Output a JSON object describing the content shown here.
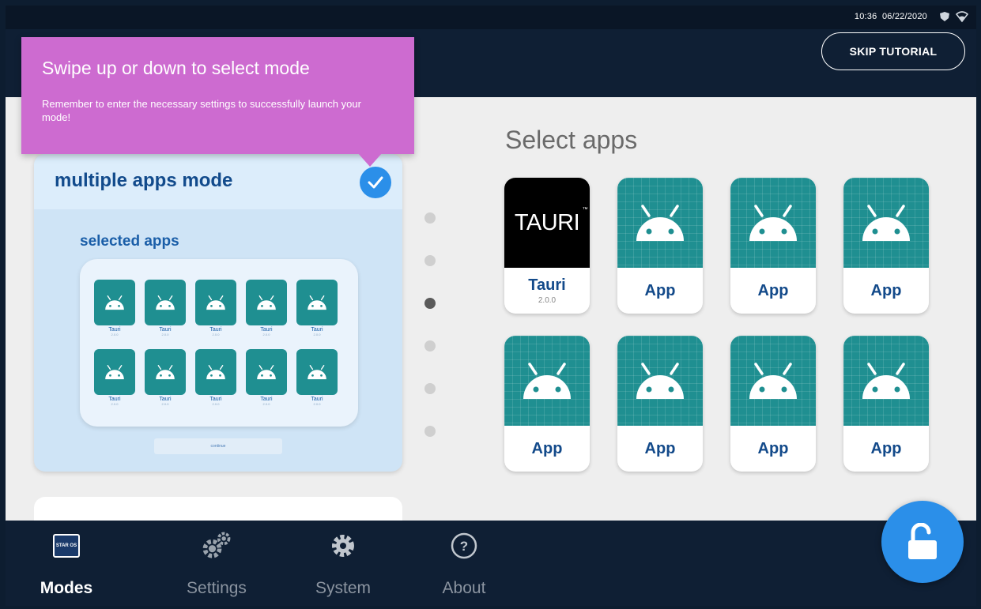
{
  "status_bar": {
    "time": "10:36",
    "date": "06/22/2020",
    "icons": [
      "shield-icon",
      "wifi-icon"
    ]
  },
  "header": {
    "skip_label": "SKIP TUTORIAL"
  },
  "tooltip": {
    "title": "Swipe up or down to select mode",
    "body": "Remember to enter the necessary settings to successfully launch your mode!"
  },
  "mode_card": {
    "title": "multiple apps mode",
    "selected_label": "selected apps",
    "mini_apps": [
      {
        "name": "Tauri",
        "ver": "2.0.0"
      },
      {
        "name": "Tauri",
        "ver": "2.0.0"
      },
      {
        "name": "Tauri",
        "ver": "2.0.0"
      },
      {
        "name": "Tauri",
        "ver": "2.0.0"
      },
      {
        "name": "Tauri",
        "ver": "2.0.0"
      },
      {
        "name": "Tauri",
        "ver": "2.0.0"
      },
      {
        "name": "Tauri",
        "ver": "2.0.0"
      },
      {
        "name": "Tauri",
        "ver": "2.0.0"
      },
      {
        "name": "Tauri",
        "ver": "2.0.0"
      },
      {
        "name": "Tauri",
        "ver": "2.0.0"
      }
    ],
    "mini_button": "continue"
  },
  "pagination": {
    "count": 6,
    "active_index": 2
  },
  "apps_section": {
    "heading": "Select apps",
    "apps": [
      {
        "name": "Tauri",
        "version": "2.0.0",
        "logo": "TAURI",
        "icon": "tauri-logo"
      },
      {
        "name": "App",
        "version": "",
        "icon": "android-icon"
      },
      {
        "name": "App",
        "version": "",
        "icon": "android-icon"
      },
      {
        "name": "App",
        "version": "",
        "icon": "android-icon"
      },
      {
        "name": "App",
        "version": "",
        "icon": "android-icon"
      },
      {
        "name": "App",
        "version": "",
        "icon": "android-icon"
      },
      {
        "name": "App",
        "version": "",
        "icon": "android-icon"
      },
      {
        "name": "App",
        "version": "",
        "icon": "android-icon"
      }
    ]
  },
  "bottom_nav": {
    "items": [
      {
        "label": "Modes",
        "icon": "staros-icon",
        "active": true
      },
      {
        "label": "Settings",
        "icon": "gears-icon",
        "active": false
      },
      {
        "label": "System",
        "icon": "gear-icon",
        "active": false
      },
      {
        "label": "About",
        "icon": "help-icon",
        "active": false
      }
    ],
    "staros_text": "STAR OS"
  },
  "fab": {
    "icon": "unlock-icon"
  },
  "colors": {
    "accent": "#2b8fe9",
    "tooltip": "#cd6bd0",
    "header": "#0f1f34",
    "app_teal": "#1f8f91"
  }
}
